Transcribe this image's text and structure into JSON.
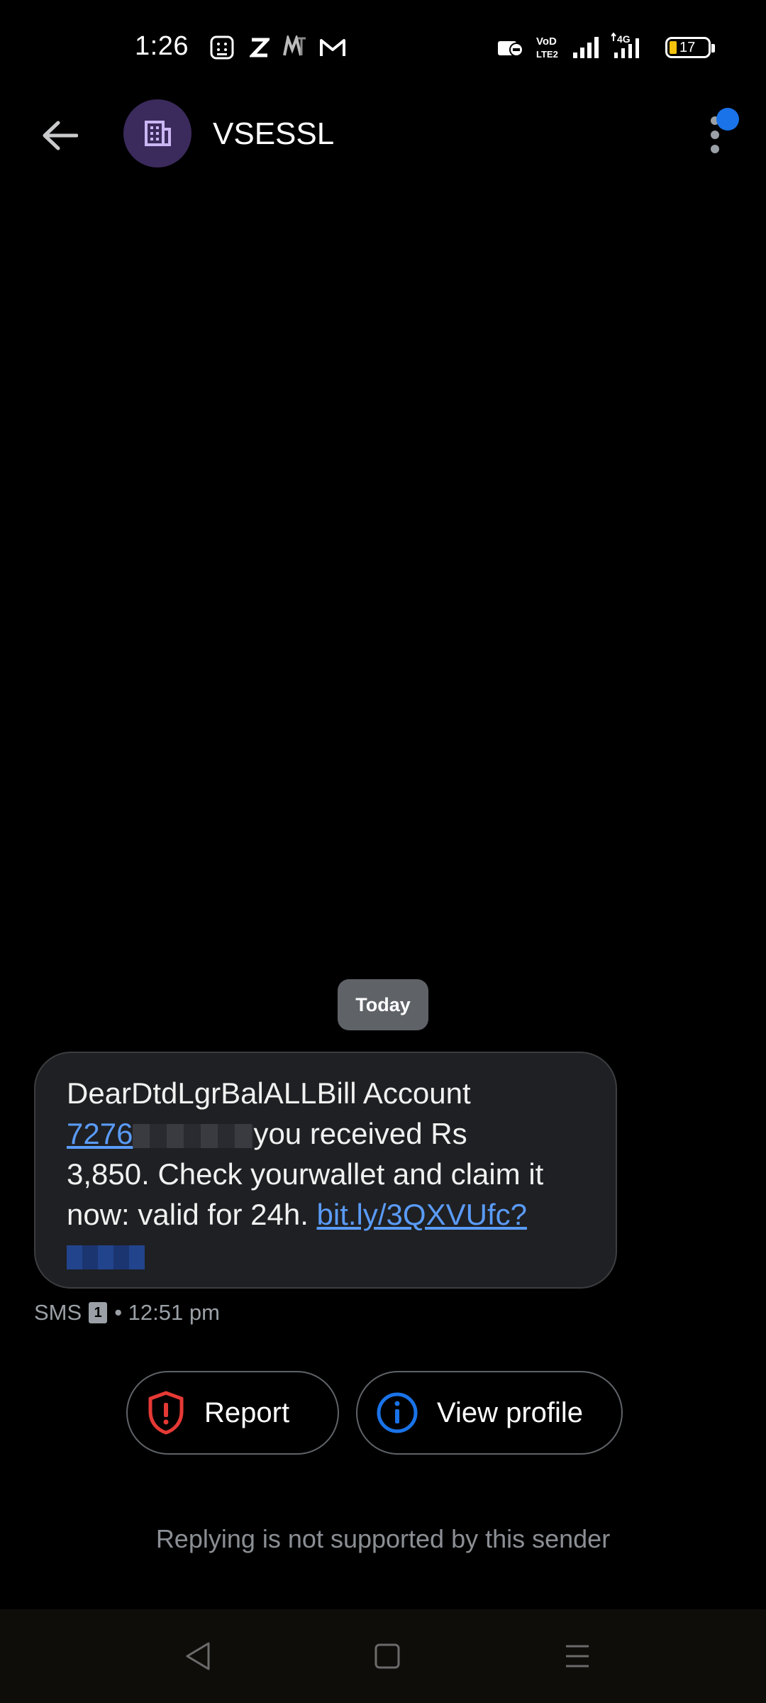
{
  "status_bar": {
    "time": "1:26",
    "battery": "17",
    "network": "4G",
    "volte": "VoLTE2"
  },
  "header": {
    "title": "VSESSL",
    "avatar_icon": "business-icon"
  },
  "conversation": {
    "date_label": "Today",
    "message": {
      "line1": "DearDtdLgrBalALLBill Account",
      "number_visible": "7276",
      "after_number": "you received Rs",
      "line3": "3,850. Check yourwallet and claim it",
      "line4_text": "now: valid for 24h. ",
      "link_visible": "bit.ly/3QXVUfc?"
    },
    "meta": {
      "type": "SMS",
      "sim": "1",
      "time": "• 12:51 pm"
    }
  },
  "actions": {
    "report_label": "Report",
    "view_profile_label": "View profile"
  },
  "footer_note": "Replying is not supported by this sender",
  "colors": {
    "background": "#000000",
    "bubble": "#1f2023",
    "link": "#5a9bf8",
    "report_icon": "#e53935",
    "profile_icon": "#1a73e8"
  }
}
